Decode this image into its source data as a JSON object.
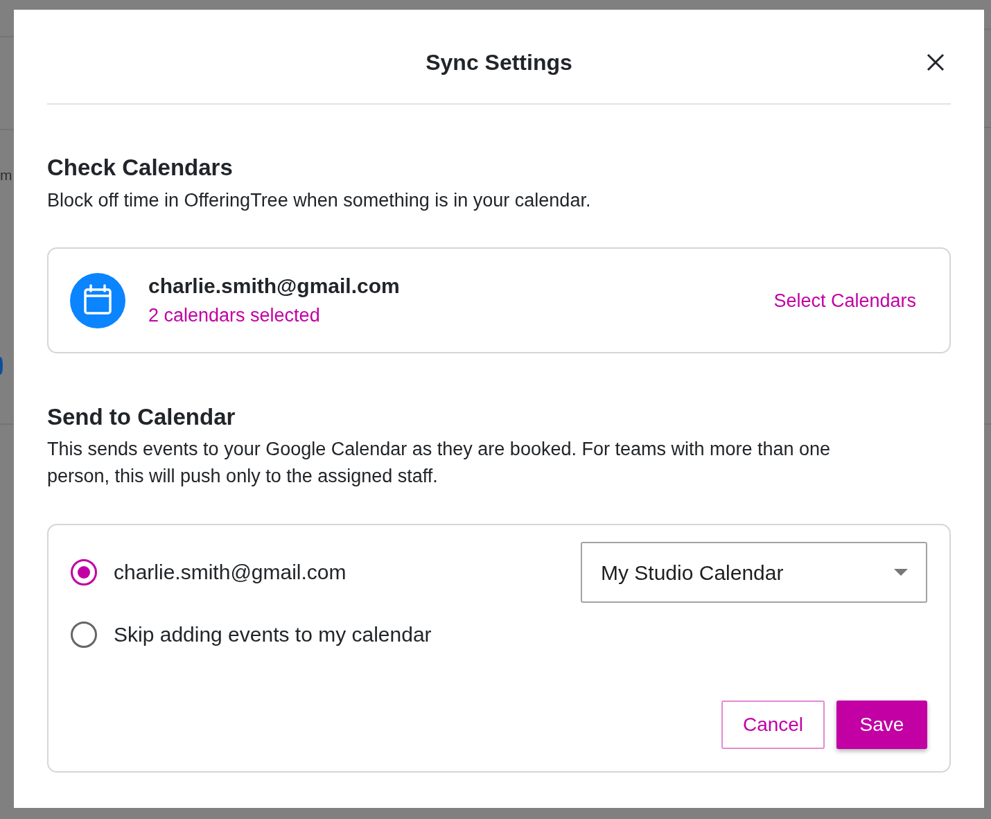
{
  "background": {
    "partial_text": "m"
  },
  "dialog": {
    "title": "Sync Settings"
  },
  "check_calendars": {
    "heading": "Check Calendars",
    "description": "Block off time in OfferingTree when something is in your calendar.",
    "account": {
      "email": "charlie.smith@gmail.com",
      "status": "2 calendars selected",
      "action": "Select Calendars"
    }
  },
  "send_to_calendar": {
    "heading": "Send to Calendar",
    "description": "This sends events to your Google Calendar as they are booked. For teams with more than one person, this will push only to the assigned staff.",
    "options": [
      {
        "label": "charlie.smith@gmail.com",
        "selected": true,
        "calendar": {
          "value": "My Studio Calendar"
        }
      },
      {
        "label": "Skip adding events to my calendar",
        "selected": false
      }
    ]
  },
  "buttons": [
    {
      "label": "Cancel",
      "kind": "secondary"
    },
    {
      "label": "Save",
      "kind": "primary"
    }
  ]
}
